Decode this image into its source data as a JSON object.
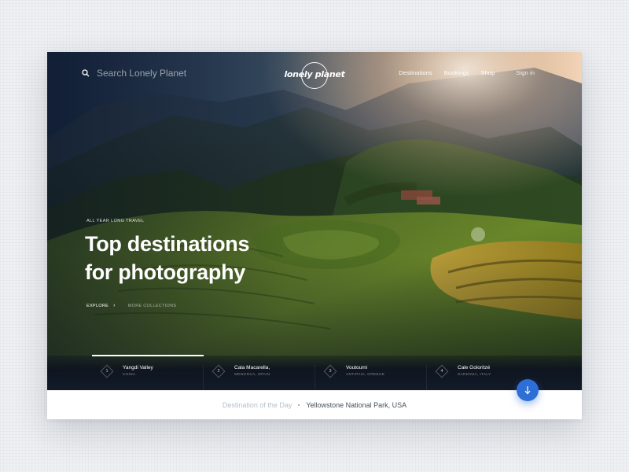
{
  "header": {
    "search_placeholder": "Search Lonely Planet",
    "logo_text": "lonely planet",
    "nav": [
      "Destinations",
      "Bookings",
      "Shop"
    ],
    "signin": "Sign in"
  },
  "hero": {
    "eyebrow": "ALL YEAR LONG TRAVEL",
    "title_line1": "Top destinations",
    "title_line2": "for photography",
    "explore": "EXPLORE",
    "more": "MORE COLLECTIONS"
  },
  "destinations": [
    {
      "num": "1",
      "name": "Yangdi Valley",
      "location": "CHINA"
    },
    {
      "num": "2",
      "name": "Cala Macarella,",
      "location": "MENORCA, SPAIN"
    },
    {
      "num": "3",
      "name": "Voutoumi",
      "location": "ANTIPAXI, GREECE"
    },
    {
      "num": "4",
      "name": "Cale Goloritzé",
      "location": "SARDINIA, ITALY"
    }
  ],
  "active_destination_progress": 1.0,
  "footer": {
    "label": "Destination of the Day",
    "place": "Yellowstone National Park, USA"
  },
  "colors": {
    "accent": "#2d6fd6",
    "page_background": "#eef0f3"
  },
  "icons": {
    "search": "search-icon",
    "explore": "chevron-right-icon",
    "scroll": "arrow-down-icon"
  }
}
